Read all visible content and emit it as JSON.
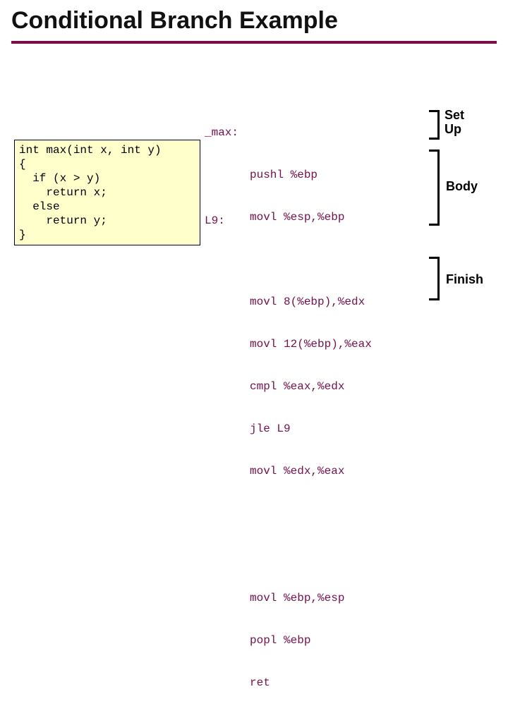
{
  "title": "Conditional Branch Example",
  "ccode": "int max(int x, int y)\n{\n  if (x > y)\n    return x;\n  else\n    return y;\n}",
  "asm": {
    "label_max": "_max:",
    "setup": [
      "pushl %ebp",
      "movl %esp,%ebp"
    ],
    "body": [
      "movl 8(%ebp),%edx",
      "movl 12(%ebp),%eax",
      "cmpl %eax,%edx",
      "jle L9",
      "movl %edx,%eax"
    ],
    "label_l9": "L9:",
    "finish": [
      "movl %ebp,%esp",
      "popl %ebp",
      "ret"
    ]
  },
  "annotations": {
    "setup": "Set\nUp",
    "body": "Body",
    "finish": "Finish"
  }
}
